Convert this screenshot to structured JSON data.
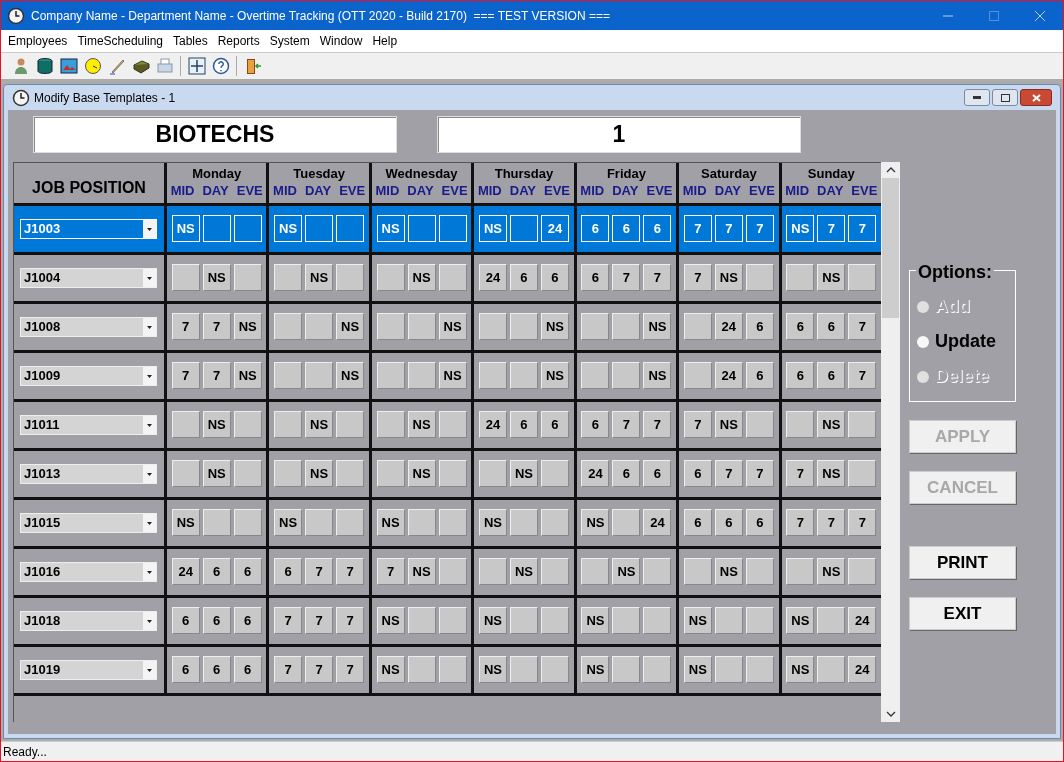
{
  "window": {
    "title": "Company Name - Department Name - Overtime Tracking (OTT 2020 - Build 2170)  === TEST VERSION ==="
  },
  "menu": [
    "Employees",
    "TimeScheduling",
    "Tables",
    "Reports",
    "System",
    "Window",
    "Help"
  ],
  "child_window": {
    "title": "Modify Base Templates - 1"
  },
  "header_fields": [
    "BIOTECHS",
    "1"
  ],
  "grid": {
    "job_heading": "JOB POSITION",
    "days": [
      {
        "name": "Monday",
        "shifts": [
          "MID",
          "DAY",
          "EVE"
        ]
      },
      {
        "name": "Tuesday",
        "shifts": [
          "MID",
          "DAY",
          "EVE"
        ]
      },
      {
        "name": "Wednesday",
        "shifts": [
          "MID",
          "DAY",
          "EVE"
        ]
      },
      {
        "name": "Thursday",
        "shifts": [
          "MID",
          "DAY",
          "EVE"
        ]
      },
      {
        "name": "Friday",
        "shifts": [
          "MID",
          "DAY",
          "EVE"
        ]
      },
      {
        "name": "Saturday",
        "shifts": [
          "MID",
          "DAY",
          "EVE"
        ]
      },
      {
        "name": "Sunday",
        "shifts": [
          "MID",
          "DAY",
          "EVE"
        ]
      }
    ],
    "rows": [
      {
        "job": "J1003",
        "selected": true,
        "cells": [
          [
            "NS",
            null,
            null
          ],
          [
            "NS",
            null,
            null
          ],
          [
            "NS",
            null,
            null
          ],
          [
            "NS",
            null,
            "24"
          ],
          [
            "6",
            "6",
            "6"
          ],
          [
            "7",
            "7",
            "7"
          ],
          [
            "NS",
            "7",
            "7"
          ]
        ]
      },
      {
        "job": "J1004",
        "selected": false,
        "cells": [
          [
            null,
            "NS",
            null
          ],
          [
            null,
            "NS",
            null
          ],
          [
            null,
            "NS",
            null
          ],
          [
            "24",
            "6",
            "6"
          ],
          [
            "6",
            "7",
            "7"
          ],
          [
            "7",
            "NS",
            null
          ],
          [
            null,
            "NS",
            null
          ]
        ]
      },
      {
        "job": "J1008",
        "selected": false,
        "cells": [
          [
            "7",
            "7",
            "NS"
          ],
          [
            null,
            null,
            "NS"
          ],
          [
            null,
            null,
            "NS"
          ],
          [
            null,
            null,
            "NS"
          ],
          [
            null,
            null,
            "NS"
          ],
          [
            null,
            "24",
            "6"
          ],
          [
            "6",
            "6",
            "7"
          ]
        ]
      },
      {
        "job": "J1009",
        "selected": false,
        "cells": [
          [
            "7",
            "7",
            "NS"
          ],
          [
            null,
            null,
            "NS"
          ],
          [
            null,
            null,
            "NS"
          ],
          [
            null,
            null,
            "NS"
          ],
          [
            null,
            null,
            "NS"
          ],
          [
            null,
            "24",
            "6"
          ],
          [
            "6",
            "6",
            "7"
          ]
        ]
      },
      {
        "job": "J1011",
        "selected": false,
        "cells": [
          [
            null,
            "NS",
            null
          ],
          [
            null,
            "NS",
            null
          ],
          [
            null,
            "NS",
            null
          ],
          [
            "24",
            "6",
            "6"
          ],
          [
            "6",
            "7",
            "7"
          ],
          [
            "7",
            "NS",
            null
          ],
          [
            null,
            "NS",
            null
          ]
        ]
      },
      {
        "job": "J1013",
        "selected": false,
        "cells": [
          [
            null,
            "NS",
            null
          ],
          [
            null,
            "NS",
            null
          ],
          [
            null,
            "NS",
            null
          ],
          [
            null,
            "NS",
            null
          ],
          [
            "24",
            "6",
            "6"
          ],
          [
            "6",
            "7",
            "7"
          ],
          [
            "7",
            "NS",
            null
          ]
        ]
      },
      {
        "job": "J1015",
        "selected": false,
        "cells": [
          [
            "NS",
            null,
            null
          ],
          [
            "NS",
            null,
            null
          ],
          [
            "NS",
            null,
            null
          ],
          [
            "NS",
            null,
            null
          ],
          [
            "NS",
            null,
            "24"
          ],
          [
            "6",
            "6",
            "6"
          ],
          [
            "7",
            "7",
            "7"
          ]
        ]
      },
      {
        "job": "J1016",
        "selected": false,
        "cells": [
          [
            "24",
            "6",
            "6"
          ],
          [
            "6",
            "7",
            "7"
          ],
          [
            "7",
            "NS",
            null
          ],
          [
            null,
            "NS",
            null
          ],
          [
            null,
            "NS",
            null
          ],
          [
            null,
            "NS",
            null
          ],
          [
            null,
            "NS",
            null
          ]
        ]
      },
      {
        "job": "J1018",
        "selected": false,
        "cells": [
          [
            "6",
            "6",
            "6"
          ],
          [
            "7",
            "7",
            "7"
          ],
          [
            "NS",
            null,
            null
          ],
          [
            "NS",
            null,
            null
          ],
          [
            "NS",
            null,
            null
          ],
          [
            "NS",
            null,
            null
          ],
          [
            "NS",
            null,
            "24"
          ]
        ]
      },
      {
        "job": "J1019",
        "selected": false,
        "cells": [
          [
            "6",
            "6",
            "6"
          ],
          [
            "7",
            "7",
            "7"
          ],
          [
            "NS",
            null,
            null
          ],
          [
            "NS",
            null,
            null
          ],
          [
            "NS",
            null,
            null
          ],
          [
            "NS",
            null,
            null
          ],
          [
            "NS",
            null,
            "24"
          ]
        ]
      }
    ]
  },
  "options": {
    "title": "Options:",
    "items": [
      {
        "label": "Add",
        "selected": false,
        "disabled": true
      },
      {
        "label": "Update",
        "selected": false,
        "disabled": false
      },
      {
        "label": "Delete",
        "selected": false,
        "disabled": true
      }
    ]
  },
  "buttons": [
    {
      "label": "APPLY",
      "disabled": true
    },
    {
      "label": "CANCEL",
      "disabled": true
    },
    {
      "label": "PRINT",
      "disabled": false
    },
    {
      "label": "EXIT",
      "disabled": false
    }
  ],
  "status_bar": "Ready..."
}
